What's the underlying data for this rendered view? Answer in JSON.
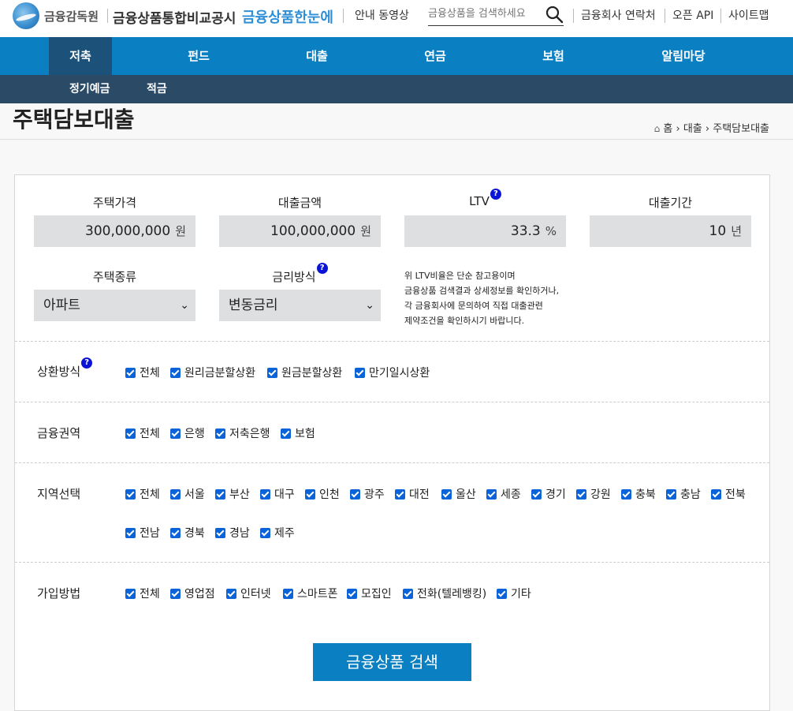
{
  "header": {
    "org_name": "금융감독원",
    "portal_name": "금융상품통합비교공시",
    "brand": "금융상품한눈에",
    "guide_video": "안내 동영상",
    "search_placeholder": "금융상품을 검색하세요",
    "contacts": "금융회사 연락처",
    "open_api": "오픈 API",
    "sitemap": "사이트맵"
  },
  "nav": {
    "items": [
      "저축",
      "펀드",
      "대출",
      "연금",
      "보험",
      "알림마당"
    ],
    "active": "저축",
    "sub_items": [
      "정기예금",
      "적금"
    ]
  },
  "page": {
    "title": "주택담보대출",
    "breadcrumb": [
      "홈",
      "대출",
      "주택담보대출"
    ]
  },
  "form": {
    "house_price": {
      "label": "주택가격",
      "value": "300,000,000",
      "unit": "원"
    },
    "loan_amount": {
      "label": "대출금액",
      "value": "100,000,000",
      "unit": "원"
    },
    "ltv": {
      "label": "LTV",
      "value": "33.3",
      "unit": "%"
    },
    "loan_period": {
      "label": "대출기간",
      "value": "10",
      "unit": "년"
    },
    "house_type": {
      "label": "주택종류",
      "value": "아파트"
    },
    "rate_type": {
      "label": "금리방식",
      "value": "변동금리"
    },
    "ltv_note": [
      "위 LTV비율은 단순 참고용이며",
      "금융상품 검색결과 상세정보를 확인하거나,",
      "각 금융회사에 문의하여 직접 대출관련",
      "제약조건을 확인하시기 바랍니다."
    ],
    "help_mark": "?"
  },
  "filters": {
    "repayment": {
      "label": "상환방식",
      "options": [
        "전체",
        "원리금분할상환",
        "원금분할상환",
        "만기일시상환"
      ]
    },
    "sector": {
      "label": "금융권역",
      "options": [
        "전체",
        "은행",
        "저축은행",
        "보험"
      ]
    },
    "region": {
      "label": "지역선택",
      "options": [
        "전체",
        "서울",
        "부산",
        "대구",
        "인천",
        "광주",
        "대전",
        "울산",
        "세종",
        "경기",
        "강원",
        "충북",
        "충남",
        "전북",
        "전남",
        "경북",
        "경남",
        "제주"
      ]
    },
    "channel": {
      "label": "가입방법",
      "options": [
        "전체",
        "영업점",
        "인터넷",
        "스마트폰",
        "모집인",
        "전화(텔레뱅킹)",
        "기타"
      ]
    }
  },
  "search_button": "금융상품 검색",
  "colors": {
    "primary": "#0a7fc2",
    "subnav": "#2a4a66",
    "active_nav": "#1c527a",
    "checkbox": "#0a63d8",
    "help": "#0b14d6"
  }
}
